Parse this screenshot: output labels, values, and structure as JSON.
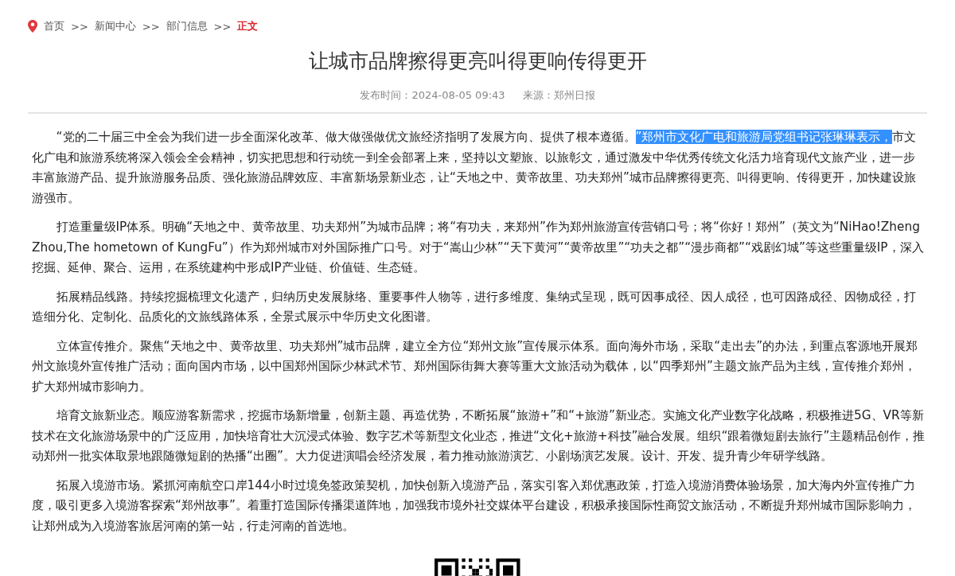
{
  "breadcrumb": [
    {
      "kind": "link",
      "text": "首页"
    },
    {
      "kind": "separator",
      "text": ">>"
    },
    {
      "kind": "link",
      "text": "新闻中心"
    },
    {
      "kind": "separator",
      "text": ">>"
    },
    {
      "kind": "link",
      "text": "部门信息"
    },
    {
      "kind": "separator",
      "text": ">>"
    },
    {
      "kind": "current",
      "text": "正文"
    }
  ],
  "article": {
    "title": "让城市品牌擦得更亮叫得更响传得更开",
    "publish_time": "发布时间：2024-08-05 09:43",
    "source": "来源：郑州日报"
  },
  "paragraphs": [
    {
      "parts": [
        {
          "text": "“党的二十届三中全会为我们进一步全面深化改革、做大做强做优文旅经济指明了发展方向、提供了根本遵循。",
          "selected": false
        },
        {
          "text": "”郑州市文化广电和旅游局党组书记张琳琳表示，",
          "selected": true
        },
        {
          "text": "市文化广电和旅游系统将深入领会全会精神，切实把思想和行动统一到全会部署上来，坚持以文塑旅、以旅彰文，通过激发中华优秀传统文化活力培育现代文旅产业，进一步丰富旅游产品、提升旅游服务品质、强化旅游品牌效应、丰富新场景新业态，让“天地之中、黄帝故里、功夫郑州”城市品牌擦得更亮、叫得更响、传得更开，加快建设旅游强市。",
          "selected": false
        }
      ]
    },
    {
      "parts": [
        {
          "text": "打造重量级IP体系。明确“天地之中、黄帝故里、功夫郑州”为城市品牌；将“有功夫，来郑州”作为郑州旅游宣传营销口号；将“你好！郑州”（英文为“NiHao!ZhengZhou,The hometown of KungFu”）作为郑州城市对外国际推广口号。对于“嵩山少林”“天下黄河”“黄帝故里”“功夫之都”“漫步商都”“戏剧幻城”等这些重量级IP，深入挖掘、延伸、聚合、运用，在系统建构中形成IP产业链、价值链、生态链。",
          "selected": false
        }
      ]
    },
    {
      "parts": [
        {
          "text": "拓展精品线路。持续挖掘梳理文化遗产，归纳历史发展脉络、重要事件人物等，进行多维度、集纳式呈现，既可因事成径、因人成径，也可因路成径、因物成径，打造细分化、定制化、品质化的文旅线路体系，全景式展示中华历史文化图谱。",
          "selected": false
        }
      ]
    },
    {
      "parts": [
        {
          "text": "立体宣传推介。聚焦“天地之中、黄帝故里、功夫郑州”城市品牌，建立全方位“郑州文旅”宣传展示体系。面向海外市场，采取“走出去”的办法，到重点客源地开展郑州文旅境外宣传推广活动；面向国内市场，以中国郑州国际少林武术节、郑州国际街舞大赛等重大文旅活动为载体，以“四季郑州”主题文旅产品为主线，宣传推介郑州，扩大郑州城市影响力。",
          "selected": false
        }
      ]
    },
    {
      "parts": [
        {
          "text": "培育文旅新业态。顺应游客新需求，挖掘市场新增量，创新主题、再造优势，不断拓展“旅游+”和“+旅游”新业态。实施文化产业数字化战略，积极推进5G、VR等新技术在文化旅游场景中的广泛应用，加快培育壮大沉浸式体验、数字艺术等新型文化业态，推进“文化+旅游+科技”融合发展。组织“跟着微短剧去旅行”主题精品创作，推动郑州一批实体取景地跟随微短剧的热播“出圈”。大力促进演唱会经济发展，着力推动旅游演艺、小剧场演艺发展。设计、开发、提升青少年研学线路。",
          "selected": false
        }
      ]
    },
    {
      "parts": [
        {
          "text": "拓展入境游市场。紧抓河南航空口岸144小时过境免签政策契机，加快创新入境游产品，落实引客入郑优惠政策，打造入境游消费体验场景，加大海内外宣传推广力度，吸引更多入境游客探索“郑州故事”。着重打造国际传播渠道阵地，加强我市境外社交媒体平台建设，积极承接国际性商贸文旅活动，不断提升郑州城市国际影响力，让郑州成为入境游客旅居河南的第一站，行走河南的首选地。",
          "selected": false
        }
      ]
    }
  ]
}
